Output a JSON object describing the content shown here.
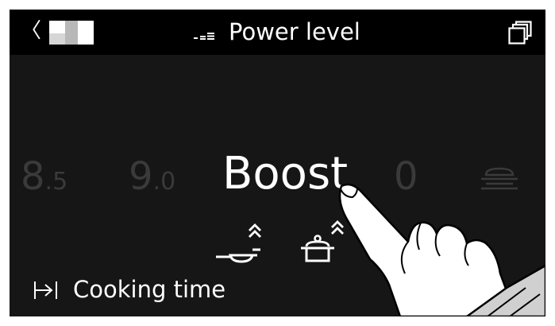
{
  "header": {
    "back_glyph": "〈",
    "title": "Power level",
    "back_icon": "chevron-left-icon",
    "logo_icon": "brand-logo-icon",
    "level_icon": "power-level-icon",
    "copy_icon": "copy-windows-icon"
  },
  "levels": {
    "prev2": {
      "main": "8",
      "frac": ".5"
    },
    "prev1": {
      "main": "9",
      "frac": ".0"
    },
    "selected": "Boost",
    "next1": "0",
    "next2_icon": "warming-tray-icon"
  },
  "boost_options": {
    "pan_icon": "frying-pan-boost-icon",
    "pot_icon": "pot-boost-icon"
  },
  "cooking_time": {
    "label": "Cooking time",
    "icon": "timer-arrow-icon"
  },
  "colors": {
    "screen_bg": "#161616",
    "topbar_bg": "#000000",
    "text_primary": "#ffffff",
    "text_dim": "#3a3a3a",
    "outer_bg": "#ffffff"
  }
}
